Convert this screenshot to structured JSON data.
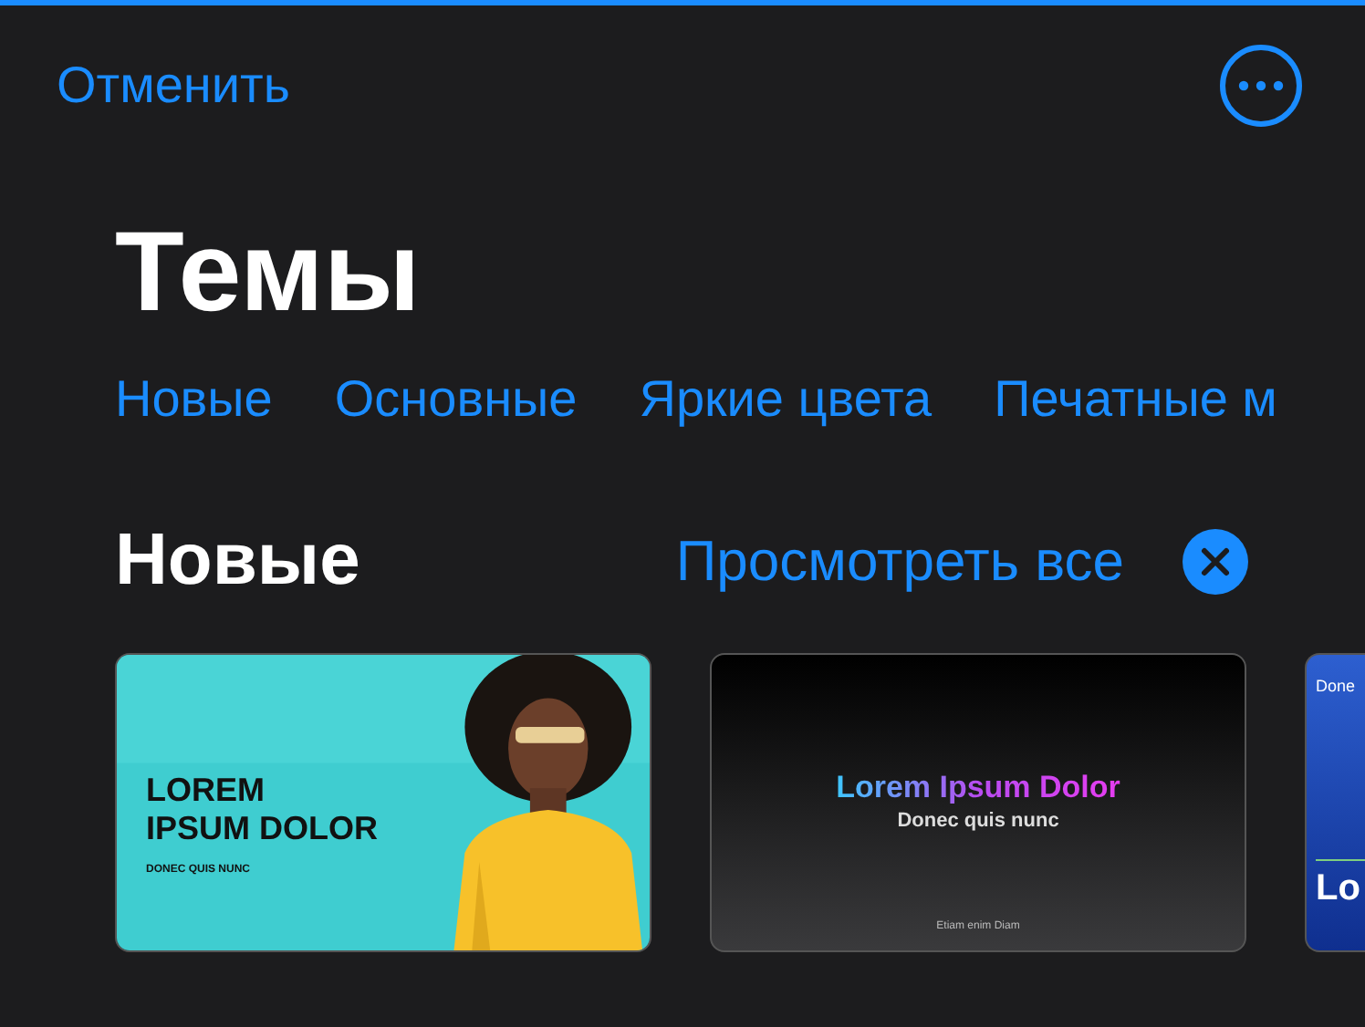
{
  "header": {
    "cancel": "Отменить"
  },
  "title": "Темы",
  "categories": [
    "Новые",
    "Основные",
    "Яркие цвета",
    "Печатные м"
  ],
  "section": {
    "title": "Новые",
    "see_all": "Просмотреть все"
  },
  "themes": [
    {
      "title_lines": [
        "LOREM",
        "IPSUM DOLOR"
      ],
      "subtitle": "DONEC QUIS NUNC"
    },
    {
      "kind": "gradient",
      "title": "Lorem Ipsum Dolor",
      "subtitle": "Donec quis nunc",
      "footer": "Etiam enim Diam"
    },
    {
      "kind": "blue",
      "top": "Done",
      "title": "Lo"
    }
  ]
}
